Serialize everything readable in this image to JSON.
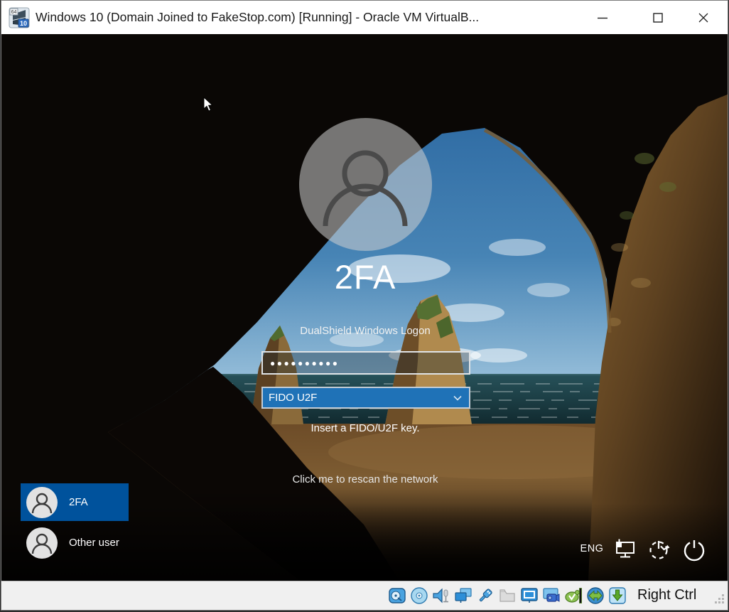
{
  "window": {
    "title": "Windows 10 (Domain Joined to FakeStop.com) [Running] - Oracle VM VirtualB...",
    "os_badge_top": "64",
    "os_badge_bottom": "10"
  },
  "lockscreen": {
    "username": "2FA",
    "subtitle": "DualShield Windows Logon",
    "password_mask": "●●●●●●●●●●",
    "auth_method": "FIDO U2F",
    "hint": "Insert a FIDO/U2F key.",
    "rescan_label": "Click me to rescan the network",
    "language": "ENG",
    "users": [
      {
        "name": "2FA",
        "selected": true
      },
      {
        "name": "Other user",
        "selected": false
      }
    ]
  },
  "statusbar": {
    "host_key_label": "Right Ctrl",
    "icons": [
      "hard-disks",
      "optical-drives",
      "audio",
      "network",
      "usb-devices",
      "shared-folders",
      "display",
      "recording",
      "features",
      "mouse-integration",
      "keyboard-capture"
    ]
  },
  "colors": {
    "selected_tile_blue": "#00529c",
    "dropdown_blue": "#1f72b7",
    "titlebar_bg": "#ffffff",
    "statusbar_bg": "#f0f0f0",
    "lock_text": "#ffffff"
  }
}
